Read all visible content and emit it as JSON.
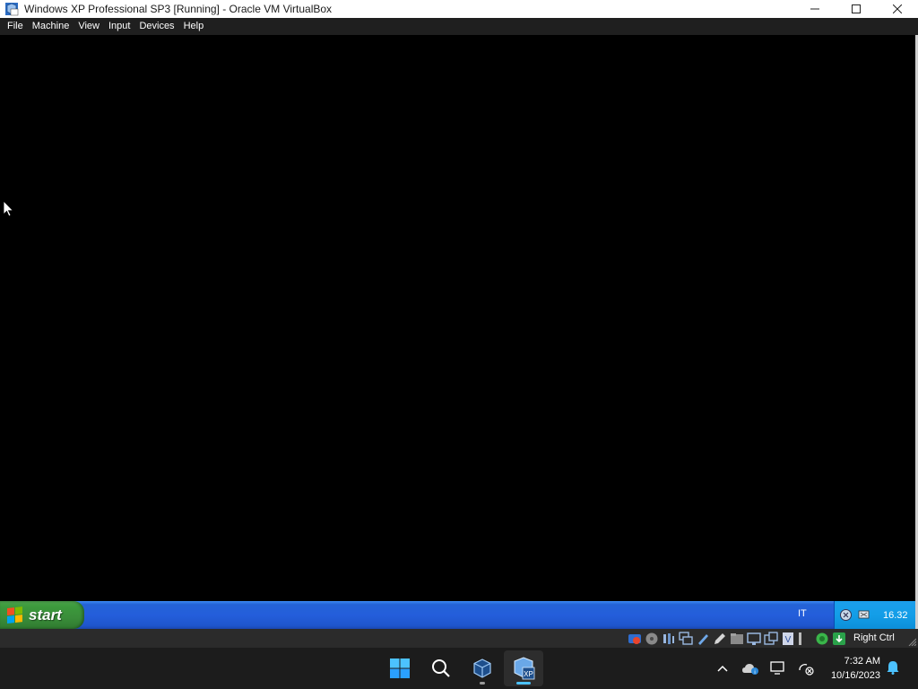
{
  "window": {
    "title": "Windows XP Professional SP3 [Running] - Oracle VM VirtualBox",
    "icon": "virtualbox-xp-icon",
    "controls": [
      "minimize-icon",
      "maximize-icon",
      "close-icon"
    ]
  },
  "menubar": {
    "items": [
      "File",
      "Machine",
      "View",
      "Input",
      "Devices",
      "Help"
    ]
  },
  "guest": {
    "taskbar": {
      "start_label": "start",
      "language": "IT",
      "clock": "16.32",
      "tray_icons": [
        "shield-icon",
        "network-icon"
      ]
    }
  },
  "status_bar": {
    "icons": [
      "optical-drive-icon",
      "disc-icon",
      "audio-icon",
      "network-adapter-icon",
      "usb-icon",
      "pencil-icon",
      "shared-folder-icon",
      "display-icon",
      "capture-icon",
      "vrde-icon",
      "recording-icon",
      "cpu-icon",
      "arrow-down-icon"
    ],
    "host_key": "Right Ctrl"
  },
  "host_taskbar": {
    "apps": [
      "windows-start-icon",
      "search-icon",
      "virtualbox-manager-icon",
      "virtualbox-vm-xp-icon"
    ],
    "tray_icons": [
      "chevron-up-icon",
      "onedrive-icon",
      "display-icon",
      "network-disconnected-icon"
    ],
    "time": "7:32 AM",
    "date": "10/16/2023",
    "accent": "#4cc2ff"
  }
}
